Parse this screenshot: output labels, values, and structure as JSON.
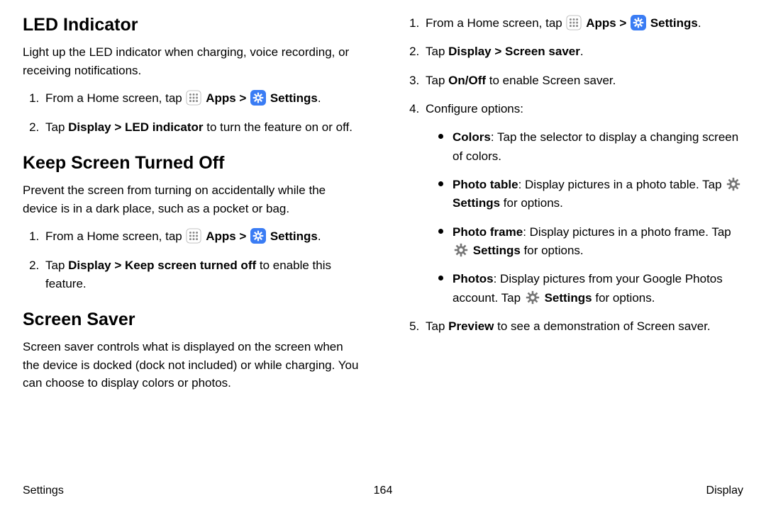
{
  "col1": {
    "sec1": {
      "heading": "LED Indicator",
      "desc": "Light up the LED indicator when charging, voice recording, or receiving notifications.",
      "step1_pre": "From a Home screen, tap ",
      "apps": "Apps",
      "sep": " > ",
      "settings": "Settings",
      "step1_post": ".",
      "step2_pre": "Tap ",
      "step2_bold": "Display > LED indicator",
      "step2_post": " to turn the feature on or off."
    },
    "sec2": {
      "heading": "Keep Screen Turned Off",
      "desc": "Prevent the screen from turning on accidentally while the device is in a dark place, such as a pocket or bag.",
      "step1_pre": "From a Home screen, tap ",
      "apps": "Apps",
      "sep": " > ",
      "settings": "Settings",
      "step1_post": ".",
      "step2_pre": "Tap ",
      "step2_bold": "Display > Keep screen turned off",
      "step2_post": " to enable this feature."
    },
    "sec3": {
      "heading": "Screen Saver",
      "desc": "Screen saver controls what is displayed on the screen when the device is docked (dock not included) or while charging. You can choose to display colors or photos."
    }
  },
  "col2": {
    "step1_pre": "From a Home screen, tap ",
    "apps": "Apps",
    "sep": " > ",
    "settings": "Settings",
    "step1_post": ".",
    "step2_pre": "Tap ",
    "step2_bold": "Display > Screen saver",
    "step2_post": ".",
    "step3_pre": "Tap ",
    "step3_bold": "On/Off",
    "step3_post": " to enable Screen saver.",
    "step4": "Configure options:",
    "b1_bold": "Colors",
    "b1_rest": ": Tap the selector to display a changing screen of colors.",
    "b2_bold": "Photo table",
    "b2_mid": ": Display pictures in a photo table. Tap ",
    "b2_set": "Settings",
    "b2_end": " for options.",
    "b3_bold": "Photo frame",
    "b3_mid": ": Display pictures in a photo frame. Tap ",
    "b3_set": "Settings",
    "b3_end": " for options.",
    "b4_bold": "Photos",
    "b4_mid": ": Display pictures from your Google Photos account. Tap ",
    "b4_set": "Settings",
    "b4_end": " for options.",
    "step5_pre": "Tap ",
    "step5_bold": "Preview",
    "step5_post": " to see a demonstration of Screen saver."
  },
  "footer": {
    "left": "Settings",
    "page": "164",
    "right": "Display"
  }
}
